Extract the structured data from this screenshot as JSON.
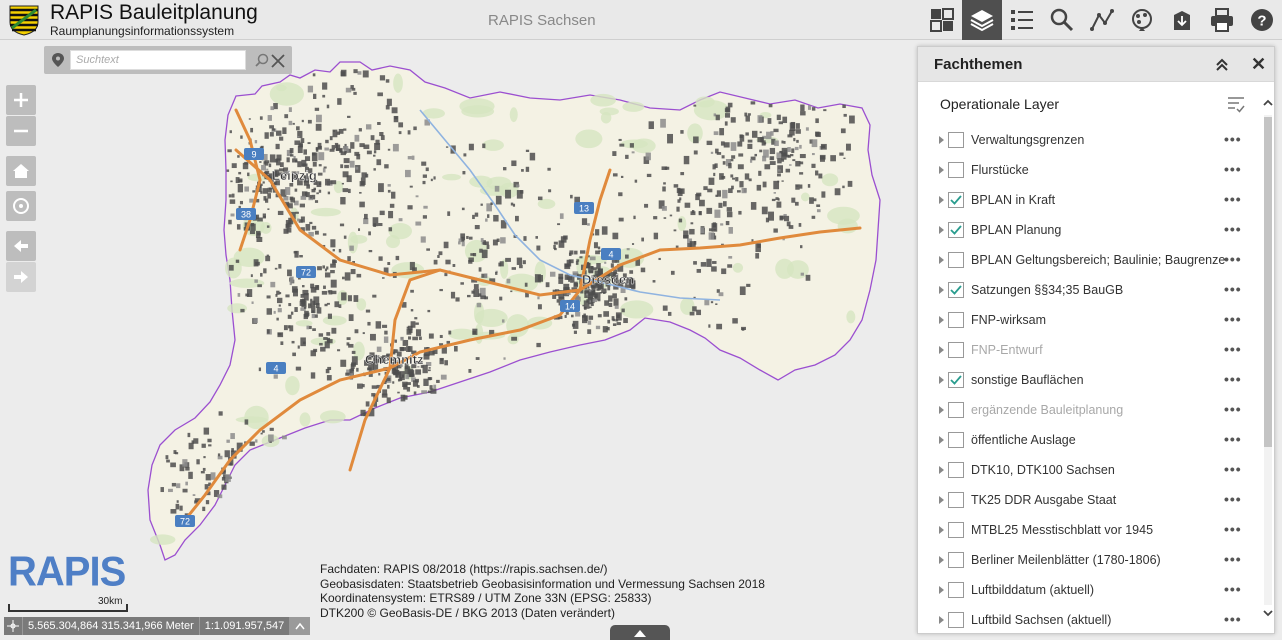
{
  "header": {
    "title": "RAPIS Bauleitplanung",
    "subtitle": "Raumplanungsinformationssystem",
    "center_title": "RAPIS Sachsen",
    "accent_color": "#4f4f4f",
    "toolbar_icons": [
      "widgets-icon",
      "layers-icon",
      "legend-icon",
      "search-icon",
      "measure-icon",
      "basemap-icon",
      "bookmark-icon",
      "print-icon",
      "help-icon"
    ]
  },
  "map": {
    "search_placeholder": "Suchtext",
    "city_labels": [
      "Leipzig",
      "Dresden",
      "Chemnitz"
    ],
    "road_shields": [
      "9",
      "38",
      "72",
      "4",
      "13",
      "4",
      "72",
      "14"
    ],
    "logo_text": "RAPIS",
    "scale_label": "30km",
    "coordinates": "5.565.304,864 315.341,966 Meter",
    "scale_ratio": "1:1.091.957,547",
    "attribution": [
      "Fachdaten: RAPIS 08/2018 (https://rapis.sachsen.de/)",
      "Geobasisdaten: Staatsbetrieb Geobasisinformation und Vermessung Sachsen 2018",
      "Koordinatensystem: ETRS89 / UTM Zone 33N (EPSG: 25833)",
      "DTK200 © GeoBasis-DE / BKG 2013 (Daten verändert)"
    ],
    "land_color": "#f5f3e8",
    "border_color": "#a54fd0",
    "highway_color": "#e08a3c"
  },
  "panel": {
    "title": "Fachthemen",
    "heading": "Operationale Layer",
    "layers": [
      {
        "label": "Verwaltungsgrenzen",
        "checked": false,
        "disabled": false
      },
      {
        "label": "Flurstücke",
        "checked": false,
        "disabled": false
      },
      {
        "label": "BPLAN in Kraft",
        "checked": true,
        "disabled": false
      },
      {
        "label": "BPLAN Planung",
        "checked": true,
        "disabled": false
      },
      {
        "label": "BPLAN Geltungsbereich; Baulinie; Baugrenze",
        "checked": false,
        "disabled": false
      },
      {
        "label": "Satzungen §§34;35 BauGB",
        "checked": true,
        "disabled": false
      },
      {
        "label": "FNP-wirksam",
        "checked": false,
        "disabled": false
      },
      {
        "label": "FNP-Entwurf",
        "checked": false,
        "disabled": true
      },
      {
        "label": "sonstige Bauflächen",
        "checked": true,
        "disabled": false
      },
      {
        "label": "ergänzende Bauleitplanung",
        "checked": false,
        "disabled": true
      },
      {
        "label": "öffentliche Auslage",
        "checked": false,
        "disabled": false
      },
      {
        "label": "DTK10, DTK100 Sachsen",
        "checked": false,
        "disabled": false
      },
      {
        "label": "TK25 DDR Ausgabe Staat",
        "checked": false,
        "disabled": false
      },
      {
        "label": "MTBL25 Messtischblatt vor 1945",
        "checked": false,
        "disabled": false
      },
      {
        "label": "Berliner Meilenblätter (1780-1806)",
        "checked": false,
        "disabled": false
      },
      {
        "label": "Luftbilddatum (aktuell)",
        "checked": false,
        "disabled": false
      },
      {
        "label": "Luftbild Sachsen (aktuell)",
        "checked": false,
        "disabled": false
      }
    ],
    "more_label": "•••"
  }
}
